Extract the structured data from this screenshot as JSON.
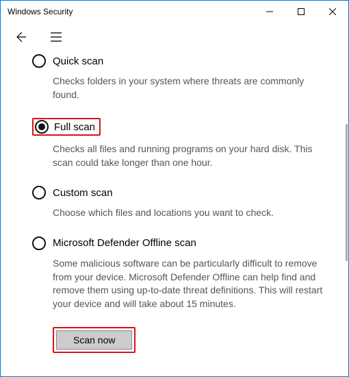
{
  "window": {
    "title": "Windows Security"
  },
  "options": {
    "quick": {
      "label": "Quick scan",
      "desc": "Checks folders in your system where threats are commonly found."
    },
    "full": {
      "label": "Full scan",
      "desc": "Checks all files and running programs on your hard disk. This scan could take longer than one hour."
    },
    "custom": {
      "label": "Custom scan",
      "desc": "Choose which files and locations you want to check."
    },
    "offline": {
      "label": "Microsoft Defender Offline scan",
      "desc": "Some malicious software can be particularly difficult to remove from your device. Microsoft Defender Offline can help find and remove them using up-to-date threat definitions. This will restart your device and will take about 15 minutes."
    }
  },
  "actions": {
    "scan_now": "Scan now"
  },
  "selected": "full",
  "highlight_color": "#d81313"
}
